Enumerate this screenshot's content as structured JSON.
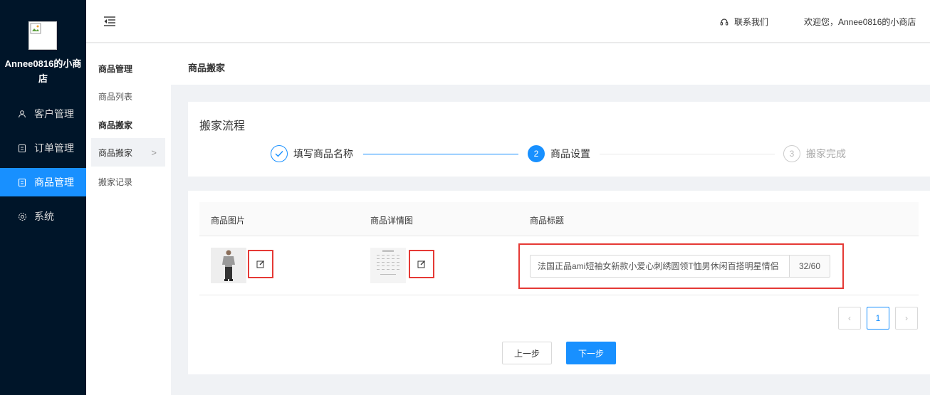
{
  "app": {
    "shop_name_line1": "Annee0816的小商",
    "shop_name_line2": "店"
  },
  "sidebar": {
    "items": [
      {
        "label": "客户管理",
        "icon": "users-icon"
      },
      {
        "label": "订单管理",
        "icon": "order-icon"
      },
      {
        "label": "商品管理",
        "icon": "product-icon",
        "active": true
      },
      {
        "label": "系统",
        "icon": "gear-icon"
      }
    ]
  },
  "header": {
    "contact_label": "联系我们",
    "welcome_text": "欢迎您，Annee0816的小商店"
  },
  "subnav": {
    "group1_title": "商品管理",
    "item_list": "商品列表",
    "group2_title": "商品搬家",
    "item_move": "商品搬家",
    "item_records": "搬家记录"
  },
  "breadcrumb": {
    "current": "商品搬家"
  },
  "flow": {
    "title": "搬家流程",
    "steps": [
      {
        "number": "✓",
        "label": "填写商品名称",
        "status": "done"
      },
      {
        "number": "2",
        "label": "商品设置",
        "status": "current"
      },
      {
        "number": "3",
        "label": "搬家完成",
        "status": "todo"
      }
    ]
  },
  "table": {
    "headers": [
      "商品图片",
      "商品详情图",
      "商品标题"
    ],
    "row": {
      "title_value": "法国正品ami短袖女新款小爱心刺绣圆领T恤男休闲百搭明星情侣",
      "title_count": "32/60"
    }
  },
  "pagination": {
    "prev": "‹",
    "current": "1",
    "next": "›"
  },
  "actions": {
    "prev_step": "上一步",
    "next_step": "下一步"
  },
  "colors": {
    "sidebar_bg": "#001529",
    "primary": "#1890ff",
    "highlight_border": "#e53935"
  }
}
